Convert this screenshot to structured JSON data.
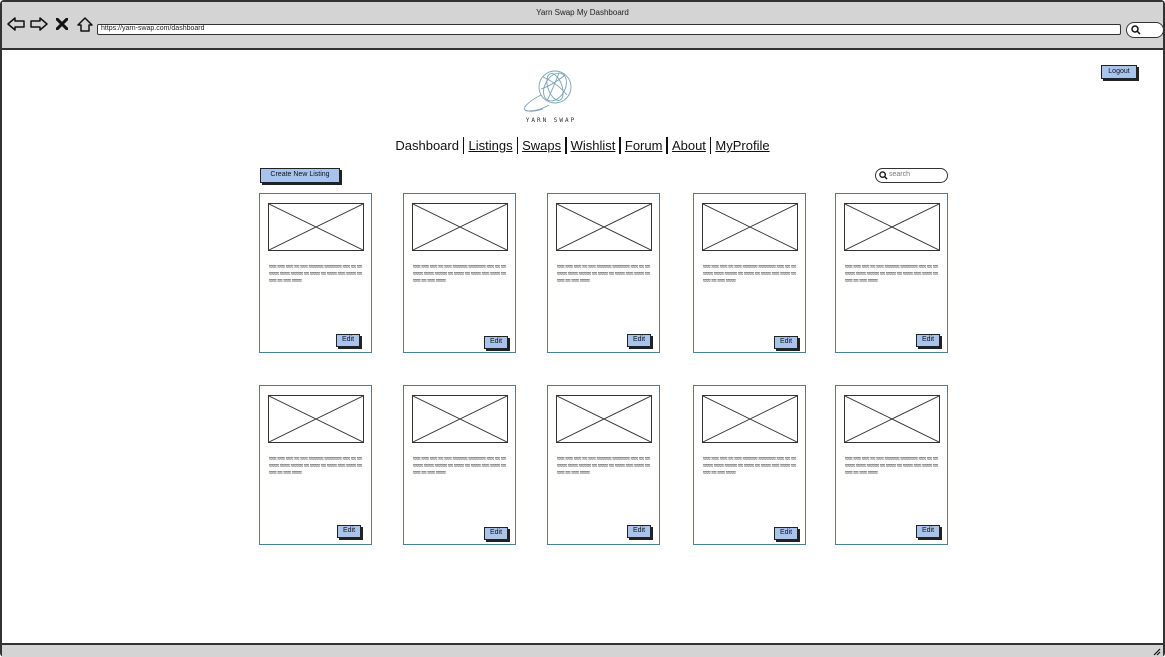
{
  "browser": {
    "window_title": "Yarn Swap My Dashboard",
    "url": "https://yarn-swap.com/dashboard",
    "icons": [
      "back-arrow-icon",
      "forward-arrow-icon",
      "close-icon",
      "home-icon",
      "search-icon",
      "resize-grip-icon"
    ]
  },
  "header": {
    "logo_text": "YARN SWAP",
    "logout_label": "Logout"
  },
  "nav": {
    "items": [
      {
        "label": "Dashboard"
      },
      {
        "label": "Listings"
      },
      {
        "label": "Swaps"
      },
      {
        "label": "Wishlist"
      },
      {
        "label": "Forum"
      },
      {
        "label": "About"
      },
      {
        "label": "MyProfile"
      }
    ]
  },
  "toolbar": {
    "create_label": "Create New Listing",
    "search_placeholder": "search"
  },
  "cards": [
    {
      "edit_label": "Edit"
    },
    {
      "edit_label": "Edit"
    },
    {
      "edit_label": "Edit"
    },
    {
      "edit_label": "Edit"
    },
    {
      "edit_label": "Edit"
    },
    {
      "edit_label": "Edit"
    },
    {
      "edit_label": "Edit"
    },
    {
      "edit_label": "Edit"
    },
    {
      "edit_label": "Edit"
    },
    {
      "edit_label": "Edit"
    }
  ],
  "colors": {
    "button_fill": "#a8c4ec",
    "card_border": "#4a7d96",
    "logo_stroke": "#7aa3b8"
  }
}
